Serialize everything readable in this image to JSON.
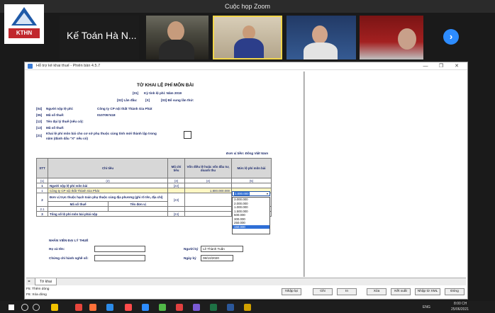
{
  "zoom": {
    "title": "Cuộc họp Zoom",
    "logo_text": "KTHN",
    "participant_name": "Kế Toán Hà N...",
    "next_label": "›"
  },
  "app": {
    "title": "Hỗ trợ kê khai thuế - Phiên bản 4.5.7",
    "controls": [
      "—",
      "❐",
      "✕"
    ]
  },
  "form": {
    "title": "TỜ KHAI LỆ PHÍ MÔN BÀI",
    "period_code": "[01]",
    "period_label": "Kỳ tính lệ phí: Năm 2019",
    "first_code": "[02] Lần đầu:",
    "first_value": "[X]",
    "supplement": "[03] Bổ sung lần thứ:",
    "payer_code": "[04]",
    "payer_label": "Người nộp lệ phí:",
    "payer_value": "Công ty CP nội thất Thành Gia Phát",
    "taxcode_code": "[05]",
    "taxcode_label": "Mã số thuế:",
    "taxcode_value": "0107057418",
    "agent_code": "[12]",
    "agent_label": "Tên đại lý thuế (nếu có):",
    "agent_tax_code": "[13]",
    "agent_tax_label": "Mã số thuế:",
    "dependent_code": "[21]",
    "dependent_label_1": "Khai lệ phí môn bài cho cơ sở phụ thuộc cùng tỉnh mới thành lập trong",
    "dependent_label_2": "năm (đánh dấu \"X\" nếu có)",
    "currency_unit": "Đơn vị tiền: Đồng Việt Nam"
  },
  "table": {
    "headers": [
      "STT",
      "Chỉ tiêu",
      "Mã chỉ tiêu",
      "Vốn điều lệ hoặc vốn đầu tư, doanh thu",
      "Mức lệ phí môn bài"
    ],
    "indices": [
      "(1)",
      "(2)",
      "(3)",
      "(4)",
      "(5)"
    ],
    "row1": {
      "stt": "1",
      "label": "Người nộp lệ phí môn bài",
      "code": "[22]"
    },
    "row1_1": {
      "stt": "1",
      "label": "Công ty CP nội thất Thành Gia Phát",
      "capital": "1.800.000.000"
    },
    "row2": {
      "stt": "2",
      "label": "Đơn vị trực thuộc hạch toán phụ thuộc cùng địa phương (ghi rõ tên, địa chỉ)",
      "code": "[23]"
    },
    "row2_sub": {
      "col_a": "Mã số thuế",
      "col_b": "Tên đơn vị"
    },
    "row2_1": {
      "stt": "2.1"
    },
    "row3": {
      "stt": "3",
      "label": "Tổng số lệ phí môn bài phải nộp",
      "code": "[24]"
    }
  },
  "fee_combo": {
    "selected": "1.000.000",
    "options": [
      "3.000.000",
      "2.000.000",
      "1.000.000",
      "1.500.000",
      "500.000",
      "300.000",
      "250.000",
      "150.000"
    ],
    "highlighted": "150.000"
  },
  "agent_staff": {
    "heading": "NHÂN VIÊN ĐẠI LÝ THUẾ",
    "name_label": "Họ và tên:",
    "cert_label": "Chứng chỉ hành nghề số:",
    "signer_label": "Người ký",
    "signer_value": "Lê Thành Tuấn",
    "date_label": "Ngày ký",
    "date_value": "08/10/2020"
  },
  "tabs": {
    "nav": "◂▸",
    "active": "Tờ khai"
  },
  "status": {
    "line1": "F5: Thêm dòng",
    "line2": "F6: Xóa dòng"
  },
  "buttons": [
    "Nhập lại",
    "Ghi",
    "In",
    "Xóa",
    "Kết xuất",
    "Nhập từ XML",
    "Đóng"
  ],
  "taskbar": {
    "lang": "ENG",
    "time": "8:00 CH",
    "date": "25/06/2021",
    "icons": [
      "windows-icon",
      "search-icon",
      "task-view-icon",
      "explorer-icon",
      "chrome-icon",
      "firefox-icon",
      "edge-icon",
      "app-icon",
      "zoom-icon",
      "coccoc-icon",
      "app2-icon",
      "store-icon",
      "excel-icon",
      "word-icon",
      "app3-icon"
    ],
    "icon_colors": [
      "#ffffff",
      "#dddddd",
      "#cccccc",
      "#f2c200",
      "#e8453c",
      "#ff7139",
      "#2c8be8",
      "#ff4b4b",
      "#2d8cff",
      "#51b848",
      "#e04040",
      "#7b5bd6",
      "#1e7145",
      "#2b579a",
      "#d0a000"
    ]
  }
}
